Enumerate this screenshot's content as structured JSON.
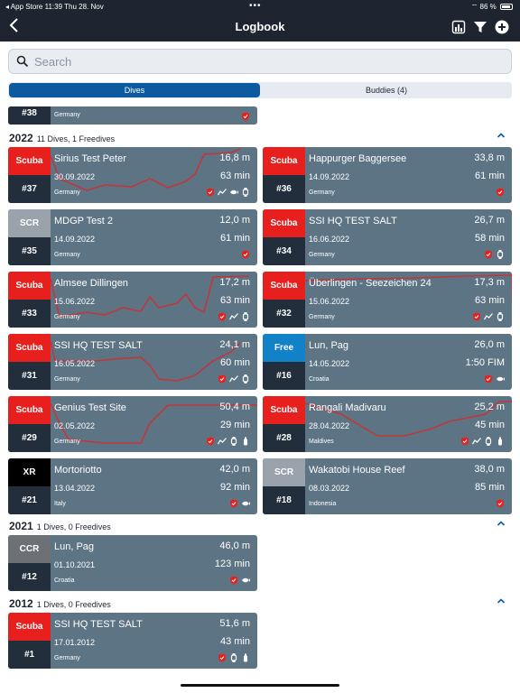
{
  "status_bar": {
    "carrier": "◂ App Store",
    "time": "11:39",
    "date": "Thu 28. Nov",
    "battery": "86 %"
  },
  "nav": {
    "title": "Logbook"
  },
  "search": {
    "placeholder": "Search"
  },
  "tabs": [
    {
      "label": "Dives"
    },
    {
      "label": "Buddies (4)"
    }
  ],
  "colors": {
    "scuba": "#e8201d",
    "scr": "#9aa3ab",
    "free": "#1182c7",
    "xr": "#000000",
    "ccr": "#6d7175",
    "card": "#5d7485",
    "card_dark": "#222e3c",
    "profile": "#c0373a",
    "accent": "#0e5a9e"
  },
  "partial_card": {
    "number": "#38",
    "country": "Germany",
    "icons": [
      "shield-icon"
    ]
  },
  "sections": [
    {
      "year": "2022",
      "count_text": "11 Dives, 1 Freedives",
      "dives": [
        {
          "type": "Scuba",
          "number": "#37",
          "name": "Sirius Test Peter",
          "date": "30.09.2022",
          "country": "Germany",
          "depth": "16,8 m",
          "duration": "63 min",
          "profile": true,
          "icons": [
            "shield-icon",
            "chart-icon",
            "fish-icon",
            "watch-icon"
          ]
        },
        {
          "type": "Scuba",
          "number": "#36",
          "name": "Happurger Baggersee",
          "date": "14.09.2022",
          "country": "Germany",
          "depth": "33,8 m",
          "duration": "61 min",
          "profile": false,
          "icons": [
            "shield-icon"
          ]
        },
        {
          "type": "SCR",
          "number": "#35",
          "name": "MDGP Test 2",
          "date": "14.09.2022",
          "country": "Germany",
          "depth": "12,0 m",
          "duration": "61 min",
          "profile": false,
          "icons": [
            "shield-icon"
          ]
        },
        {
          "type": "Scuba",
          "number": "#34",
          "name": "SSI HQ TEST SALT",
          "date": "16.06.2022",
          "country": "Germany",
          "depth": "26,7 m",
          "duration": "58 min",
          "profile": false,
          "icons": [
            "shield-icon",
            "watch-icon"
          ]
        },
        {
          "type": "Scuba",
          "number": "#33",
          "name": "Almsee Dillingen",
          "date": "15.06.2022",
          "country": "Germany",
          "depth": "17,2 m",
          "duration": "63 min",
          "profile": true,
          "icons": [
            "shield-icon",
            "chart-icon",
            "watch-icon"
          ]
        },
        {
          "type": "Scuba",
          "number": "#32",
          "name": "Überlingen - Seezeichen 24",
          "date": "15.06.2022",
          "country": "Germany",
          "depth": "17,3 m",
          "duration": "63 min",
          "profile": true,
          "icons": [
            "shield-icon",
            "chart-icon",
            "watch-icon"
          ]
        },
        {
          "type": "Scuba",
          "number": "#31",
          "name": "SSI HQ TEST SALT",
          "date": "16.05.2022",
          "country": "Germany",
          "depth": "24,1 m",
          "duration": "60 min",
          "profile": true,
          "icons": [
            "shield-icon",
            "chart-icon",
            "watch-icon"
          ]
        },
        {
          "type": "Free",
          "number": "#16",
          "name": "Lun, Pag",
          "date": "14.05.2022",
          "country": "Croatia",
          "depth": "26,0 m",
          "duration": "1:50 FIM",
          "profile": false,
          "icons": [
            "shield-icon",
            "fish-icon"
          ]
        },
        {
          "type": "Scuba",
          "number": "#29",
          "name": "Genius  Test  Site",
          "date": "02.05.2022",
          "country": "Germany",
          "depth": "50,4 m",
          "duration": "29 min",
          "profile": true,
          "icons": [
            "shield-icon",
            "chart-icon",
            "watch-icon",
            "tank-icon"
          ]
        },
        {
          "type": "Scuba",
          "number": "#28",
          "name": "Rangali Madivaru",
          "date": "28.04.2022",
          "country": "Maldives",
          "depth": "25,2 m",
          "duration": "45 min",
          "profile": true,
          "icons": [
            "shield-icon",
            "chart-icon",
            "watch-icon",
            "tank-icon"
          ]
        },
        {
          "type": "XR",
          "number": "#21",
          "name": "Mortoriotto",
          "date": "13.04.2022",
          "country": "Italy",
          "depth": "42,0 m",
          "duration": "92 min",
          "profile": false,
          "icons": [
            "shield-icon",
            "fish-icon"
          ]
        },
        {
          "type": "SCR",
          "number": "#18",
          "name": "Wakatobi House Reef",
          "date": "08.03.2022",
          "country": "Indonesia",
          "depth": "38,0 m",
          "duration": "85 min",
          "profile": false,
          "icons": [
            "shield-icon"
          ]
        }
      ]
    },
    {
      "year": "2021",
      "count_text": "1 Dives, 0 Freedives",
      "dives": [
        {
          "type": "CCR",
          "number": "#12",
          "name": "Lun, Pag",
          "date": "01.10.2021",
          "country": "Croatia",
          "depth": "46,0 m",
          "duration": "123 min",
          "profile": false,
          "icons": [
            "shield-icon",
            "fish-icon"
          ]
        }
      ]
    },
    {
      "year": "2012",
      "count_text": "1 Dives, 0 Freedives",
      "dives": [
        {
          "type": "Scuba",
          "number": "#1",
          "name": "SSI HQ TEST SALT",
          "date": "17.01.2012",
          "country": "Germany",
          "depth": "51,6 m",
          "duration": "43 min",
          "profile": false,
          "icons": [
            "shield-icon",
            "watch-icon",
            "tank-icon"
          ]
        }
      ]
    }
  ]
}
